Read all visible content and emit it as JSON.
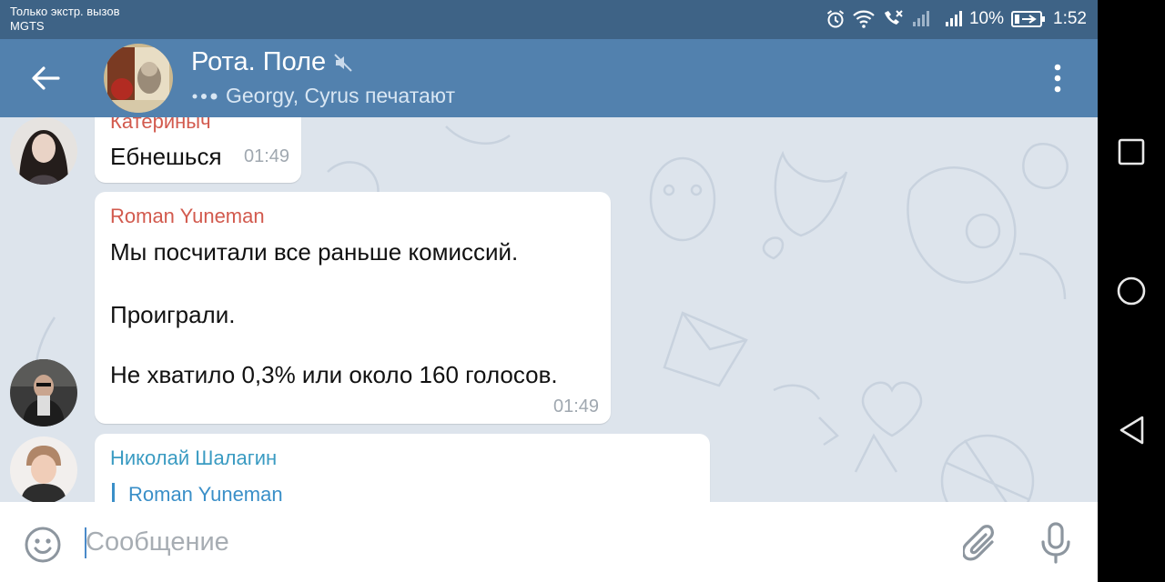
{
  "status_bar": {
    "carrier_line1": "Только экстр. вызов",
    "carrier_line2": "MGTS",
    "battery": "10%",
    "time": "1:52"
  },
  "header": {
    "title": "Рота. Поле",
    "subtitle": "Georgy, Cyrus печатают",
    "muted_icon": "muted-speaker-icon"
  },
  "messages": [
    {
      "sender": "Катериныч",
      "sender_color": "#d25a4e",
      "text": "Ебнешься",
      "time": "01:49"
    },
    {
      "sender": "Roman Yuneman",
      "sender_color": "#d25a4e",
      "lines": [
        "Мы посчитали все раньше комиссий.",
        "Проиграли.",
        "Не хватило 0,3% или около 160 голосов."
      ],
      "time": "01:49"
    },
    {
      "sender": "Николай Шалагин",
      "sender_color": "#3a9bc2",
      "reply_to": "Roman Yuneman"
    }
  ],
  "input": {
    "placeholder": "Сообщение"
  },
  "colors": {
    "status_bar": "#3e6386",
    "app_bar": "#5281ae",
    "chat_background": "#dde4ec",
    "accent": "#4a8ac9"
  }
}
